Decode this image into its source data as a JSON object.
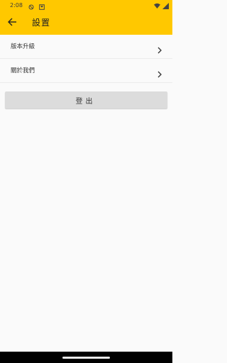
{
  "status_bar": {
    "time": "2:08",
    "left_icons": [
      "blocked-icon",
      "notification-icon"
    ],
    "right_icons": [
      "wifi-icon",
      "signal-icon"
    ]
  },
  "app_bar": {
    "title": "設置",
    "back_icon": "arrow-left-icon",
    "background": "#ffc800"
  },
  "menu": {
    "items": [
      {
        "label": "版本升級",
        "icon": "chevron-right-icon"
      },
      {
        "label": "關於我們",
        "icon": "chevron-right-icon"
      }
    ]
  },
  "actions": {
    "logout_label": "登出"
  }
}
